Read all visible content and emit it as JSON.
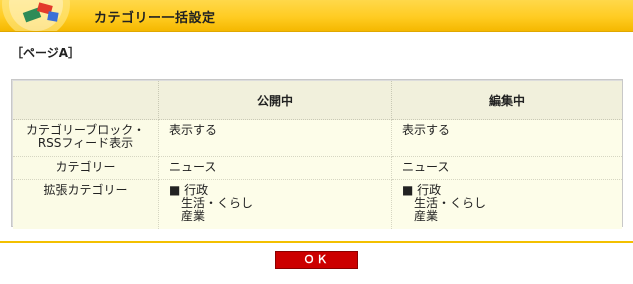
{
  "header": {
    "title": "カテゴリー一括設定"
  },
  "page_label": "［ページA］",
  "table": {
    "columns": [
      "",
      "公開中",
      "編集中"
    ],
    "rows": [
      {
        "label_line1": "カテゴリーブロック・",
        "label_line2": "RSSフィード表示",
        "public": [
          "表示する"
        ],
        "editing": [
          "表示する"
        ]
      },
      {
        "label_line1": "カテゴリー",
        "public": [
          "ニュース"
        ],
        "editing": [
          "ニュース"
        ]
      },
      {
        "label_line1": "拡張カテゴリー",
        "public": [
          "■ 行政",
          "生活・くらし",
          "産業"
        ],
        "editing": [
          "■ 行政",
          "生活・くらし",
          "産業"
        ]
      }
    ]
  },
  "ok_button": "ＯＫ"
}
